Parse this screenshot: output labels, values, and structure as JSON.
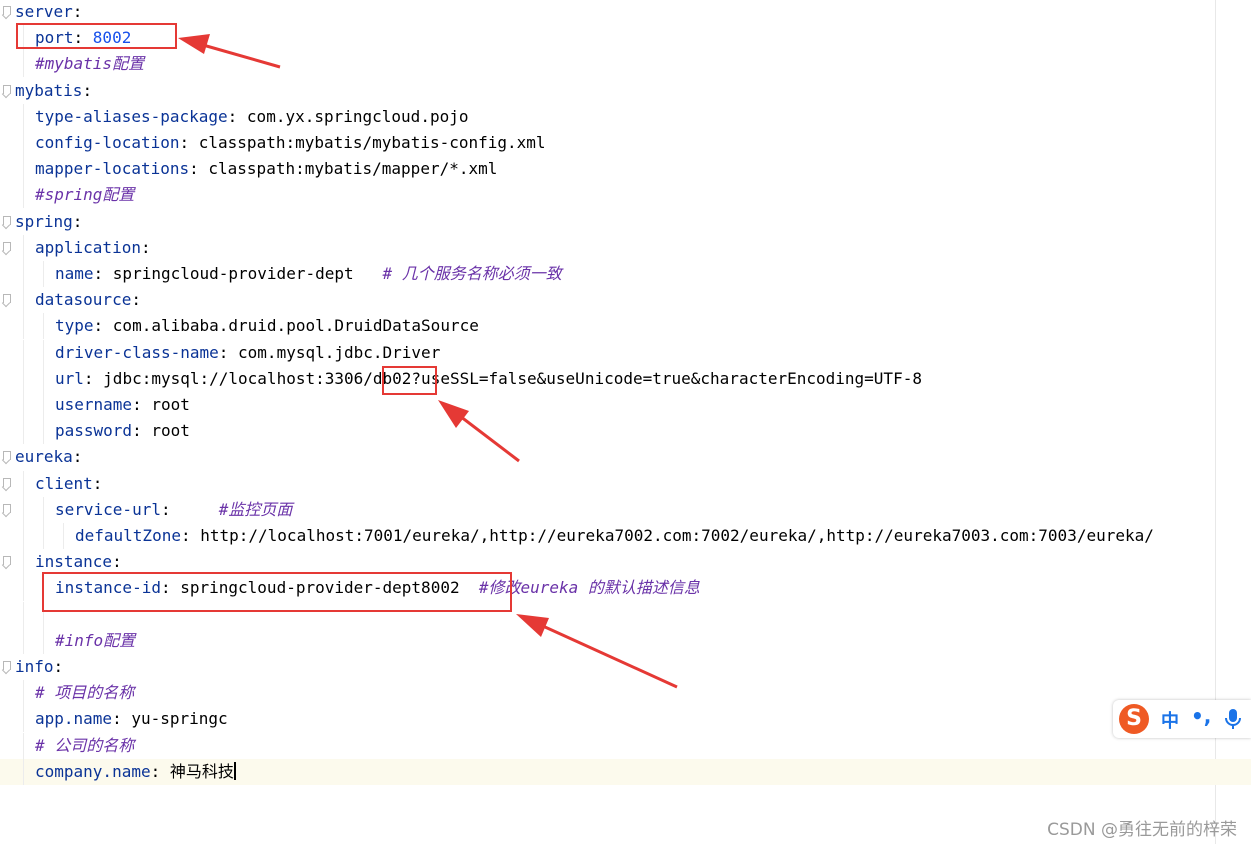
{
  "editor": {
    "lines": [
      {
        "key": "server",
        "sep": ":"
      },
      {
        "key": "port",
        "sep": ": ",
        "num": "8002"
      },
      {
        "comment": "#mybatis配置"
      },
      {
        "key": "mybatis",
        "sep": ":"
      },
      {
        "key": "type-aliases-package",
        "sep": ": ",
        "value": "com.yx.springcloud.pojo"
      },
      {
        "key": "config-location",
        "sep": ": ",
        "value": "classpath:mybatis/mybatis-config.xml"
      },
      {
        "key": "mapper-locations",
        "sep": ": ",
        "value": "classpath:mybatis/mapper/*.xml"
      },
      {
        "comment": "#spring配置"
      },
      {
        "key": "spring",
        "sep": ":"
      },
      {
        "key": "application",
        "sep": ":"
      },
      {
        "key": "name",
        "sep": ": ",
        "value": "springcloud-provider-dept   ",
        "comment": "# 几个服务名称必须一致"
      },
      {
        "key": "datasource",
        "sep": ":"
      },
      {
        "key": "type",
        "sep": ": ",
        "value": "com.alibaba.druid.pool.DruidDataSource"
      },
      {
        "key": "driver-class-name",
        "sep": ": ",
        "value": "com.mysql.jdbc.Driver"
      },
      {
        "key": "url",
        "sep": ": ",
        "value": "jdbc:mysql://localhost:3306/db02?useSSL=false&useUnicode=true&characterEncoding=UTF-8"
      },
      {
        "key": "username",
        "sep": ": ",
        "value": "root"
      },
      {
        "key": "password",
        "sep": ": ",
        "value": "root"
      },
      {
        "key": "eureka",
        "sep": ":"
      },
      {
        "key": "client",
        "sep": ":"
      },
      {
        "key": "service-url",
        "sep": ":     ",
        "comment": "#监控页面"
      },
      {
        "key": "defaultZone",
        "sep": ": ",
        "value": "http://localhost:7001/eureka/,http://eureka7002.com:7002/eureka/,http://eureka7003.com:7003/eureka/"
      },
      {
        "key": "instance",
        "sep": ":"
      },
      {
        "key": "instance-id",
        "sep": ": ",
        "value": "springcloud-provider-dept8002  ",
        "comment": "#修改eureka 的默认描述信息"
      },
      {
        "blank": ""
      },
      {
        "comment": "#info配置"
      },
      {
        "key": "info",
        "sep": ":"
      },
      {
        "comment": "# 项目的名称"
      },
      {
        "key": "app.name",
        "sep": ": ",
        "value": "yu-springc"
      },
      {
        "comment": "# 公司的名称"
      },
      {
        "key": "company.name",
        "sep": ": ",
        "value": "神马科技"
      }
    ]
  },
  "ime": {
    "logo": "S",
    "mode": "中",
    "punct": "•,"
  },
  "watermark": "CSDN @勇往无前的梓荣",
  "colors": {
    "key": "#0a3396",
    "number": "#1750eb",
    "comment": "#6a32a8",
    "highlight_box": "#e53935",
    "current_line": "#fcfaed"
  }
}
